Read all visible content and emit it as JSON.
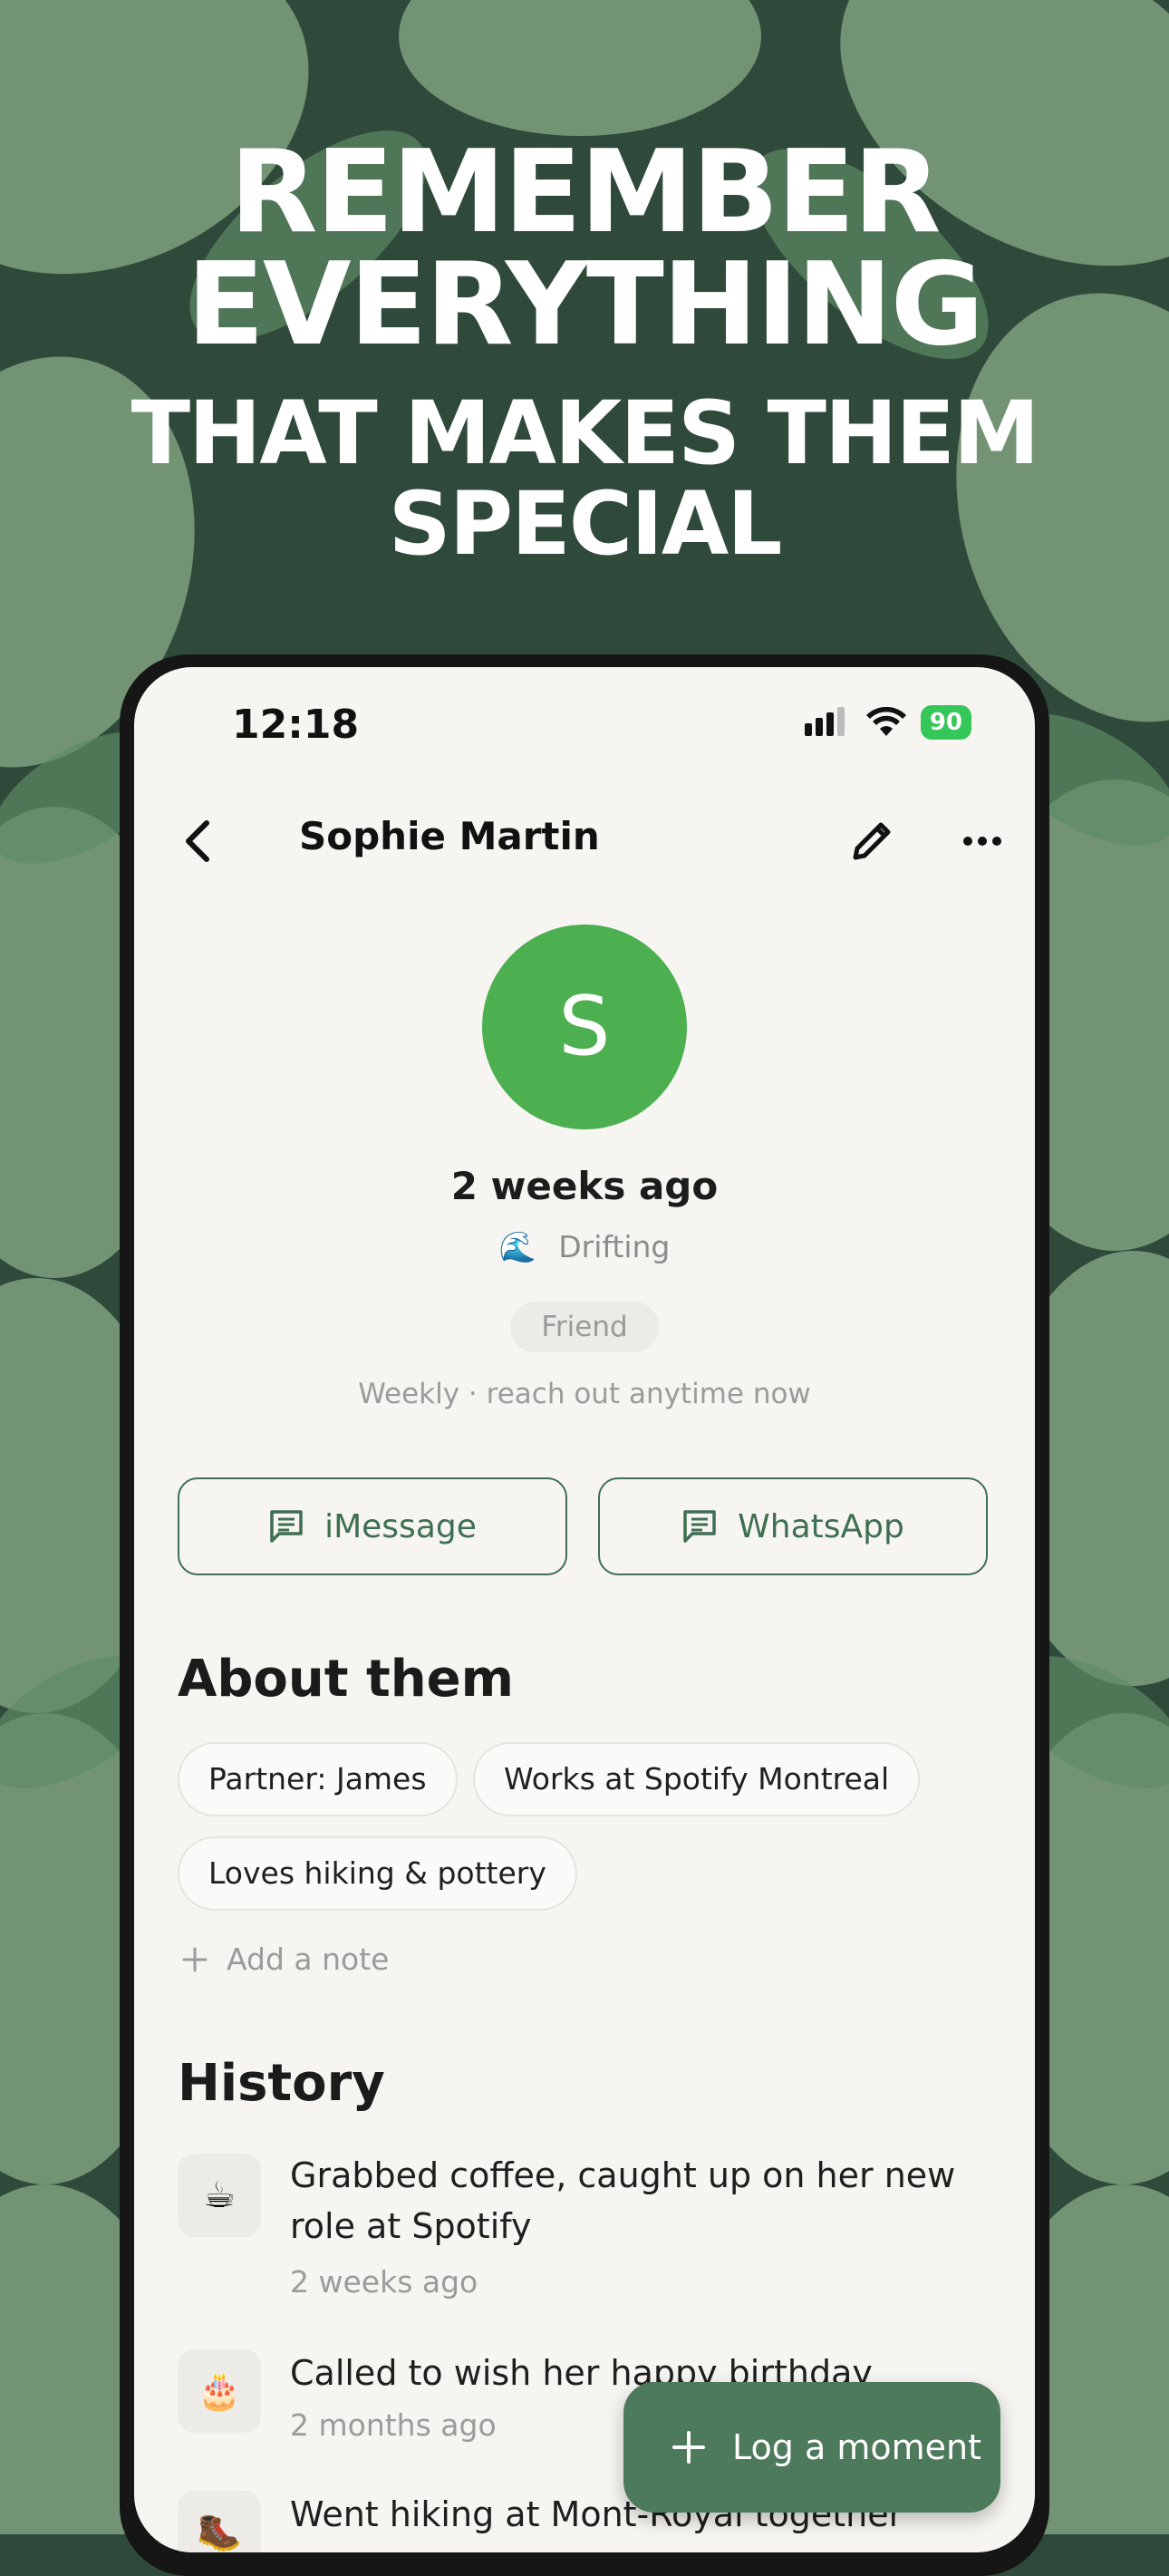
{
  "headline": {
    "line1": "REMEMBER",
    "line2": "EVERYTHING",
    "line3": "THAT MAKES THEM",
    "line4": "SPECIAL"
  },
  "status_bar": {
    "time": "12:18",
    "battery": "90"
  },
  "nav": {
    "title": "Sophie Martin",
    "back_icon": "chevron-left-icon",
    "edit_icon": "pencil-icon",
    "more_icon": "ellipsis-icon"
  },
  "profile": {
    "avatar_initial": "S",
    "avatar_color": "#4caf50",
    "last_contact": "2 weeks ago",
    "status_emoji": "🌊",
    "status": "Drifting",
    "relationship": "Friend",
    "frequency": "Weekly · reach out anytime now"
  },
  "actions": {
    "imessage": "iMessage",
    "whatsapp": "WhatsApp"
  },
  "about": {
    "title": "About them",
    "notes": [
      "Partner: James",
      "Works at Spotify Montreal",
      "Loves hiking & pottery"
    ],
    "add_note": "Add a note"
  },
  "history": {
    "title": "History",
    "items": [
      {
        "emoji": "☕",
        "text": "Grabbed coffee, caught up on her new role at Spotify",
        "time": "2 weeks ago"
      },
      {
        "emoji": "🎂",
        "text": "Called to wish her happy birthday",
        "time": "2 months ago"
      },
      {
        "emoji": "🥾",
        "text": "Went hiking at Mont-Royal together",
        "time": ""
      }
    ]
  },
  "fab": {
    "label": "Log a moment"
  },
  "colors": {
    "accent": "#3f6f53",
    "fab": "#4c7a5b",
    "background": "#2f4a3a"
  }
}
